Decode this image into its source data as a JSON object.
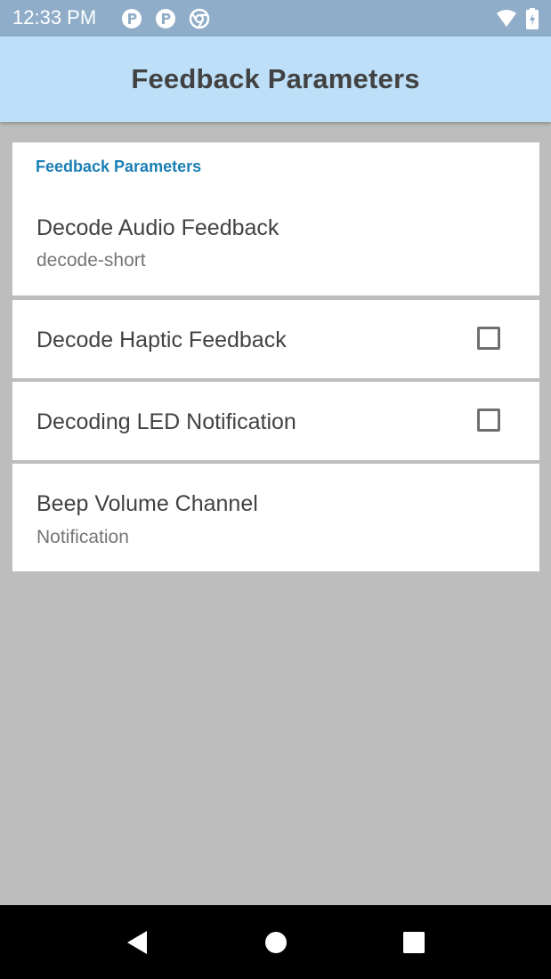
{
  "status_bar": {
    "time": "12:33 PM",
    "left_icons": [
      "notification-app-icon",
      "notification-app-icon",
      "chrome-icon"
    ],
    "right_icons": [
      "wifi-icon",
      "battery-icon"
    ]
  },
  "app_bar": {
    "title": "Feedback Parameters"
  },
  "preferences": {
    "category_title": "Feedback Parameters",
    "items": [
      {
        "title": "Decode Audio Feedback",
        "summary": "decode-short"
      },
      {
        "title": "Decode Haptic Feedback",
        "checked": false
      },
      {
        "title": "Decoding LED Notification",
        "checked": false
      },
      {
        "title": "Beep Volume Channel",
        "summary": "Notification"
      }
    ]
  },
  "nav_bar": {
    "buttons": [
      "back-icon",
      "home-icon",
      "recents-icon"
    ]
  },
  "colors": {
    "status_bar": "#8fadc9",
    "app_bar": "#bddff8",
    "accent": "#1a7fb5",
    "background": "#bdbdbd"
  }
}
